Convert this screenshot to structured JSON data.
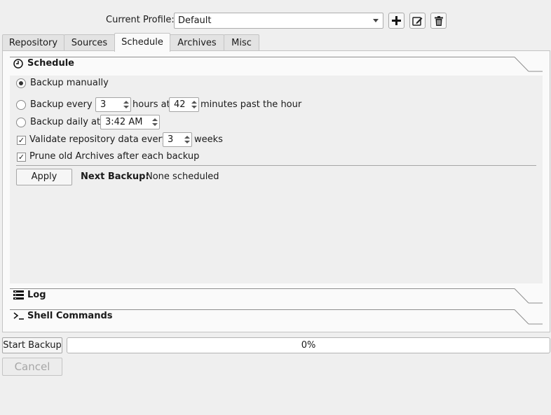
{
  "profile": {
    "label": "Current Profile:",
    "selected": "Default",
    "add_icon": "plus-icon",
    "edit_icon": "edit-icon",
    "delete_icon": "trash-icon"
  },
  "tabs": [
    {
      "label": "Repository",
      "active": false
    },
    {
      "label": "Sources",
      "active": false
    },
    {
      "label": "Schedule",
      "active": true
    },
    {
      "label": "Archives",
      "active": false
    },
    {
      "label": "Misc",
      "active": false
    }
  ],
  "schedule": {
    "title": "Schedule",
    "icon": "clock-icon",
    "backup_manually": "Backup manually",
    "backup_every": "Backup every",
    "hours_value": "3",
    "hours_at": "hours at",
    "minutes_value": "42",
    "minutes_past": "minutes past the hour",
    "backup_daily": "Backup daily at",
    "daily_time": "3:42 AM",
    "validate_label": "Validate repository data every",
    "validate_value": "3",
    "validate_unit": "weeks",
    "prune_label": "Prune old Archives after each backup",
    "apply_label": "Apply",
    "next_backup_label": "Next Backup:",
    "next_backup_value": "None scheduled",
    "selected_mode": "manual",
    "validate_checked": true,
    "prune_checked": true
  },
  "sections": {
    "log": {
      "title": "Log",
      "icon": "log-icon"
    },
    "shell": {
      "title": "Shell Commands",
      "icon": "terminal-icon"
    }
  },
  "footer": {
    "start_backup": "Start Backup",
    "cancel": "Cancel",
    "progress_text": "0%",
    "progress_value": 0
  },
  "colors": {
    "accent": "#3b8ed8",
    "window_bg": "#efefef"
  }
}
